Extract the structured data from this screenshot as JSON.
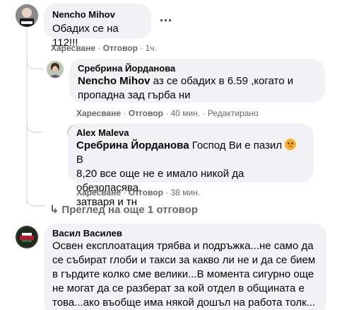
{
  "comments": [
    {
      "author": "Nencho Mihov",
      "text": "Обадих се на 112!!!",
      "like": "Харесване",
      "reply": "Отговор",
      "time": "1ч.",
      "more_icon": "more-dots-icon"
    },
    {
      "author": "Сребрина Йорданова",
      "mention": "Nencho Mihov",
      "text_line1": " аз се обадих в 6.59 ,когато и",
      "text_line2": "пропадна зад гърба ни",
      "like": "Харесване",
      "reply": "Отговор",
      "time": "40 мин.",
      "edited": "Редактирано"
    },
    {
      "author": "Alex Maleva",
      "mention": "Сребрина Йорданова",
      "text_line1": " Господ Ви е пазил ",
      "emoji": "sad-face-emoji",
      "text_line1_end": " В",
      "text_line2": "8,20 все още не е имало никой да обезопасява,",
      "text_line3": "затваря и тн",
      "like": "Харесване",
      "reply": "Отговор",
      "time": "38 мин."
    },
    {
      "author": "Васил Василев",
      "lines": [
        "Освен експлоатация трябва и подръжка...не само да",
        "се събират глоби и такси за какво ли не и да се бием",
        "в гърдите колко сме велики...В момента сигурно още",
        "не могат да се разберат за кой отдел в общината е",
        "това...ако въобще има някой дошъл на работа толк..."
      ]
    }
  ],
  "view_more": "Преглед на още 1 отговор",
  "colors": {
    "bubble": "#f0f2f5",
    "meta": "#65676b",
    "thread": "#e4e6eb"
  }
}
